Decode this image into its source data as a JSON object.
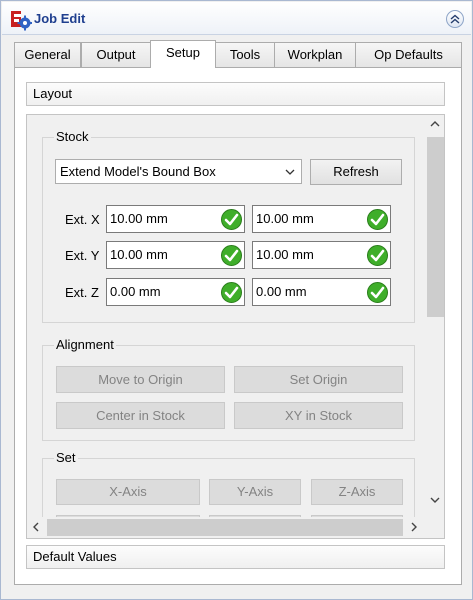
{
  "window": {
    "title": "Job Edit",
    "app_icon": "freecad-path-gear-icon",
    "collapse_icon": "double-chevron-up-icon"
  },
  "tabs": [
    {
      "label": "General",
      "active": false
    },
    {
      "label": "Output",
      "active": false
    },
    {
      "label": "Setup",
      "active": true
    },
    {
      "label": "Tools",
      "active": false
    },
    {
      "label": "Workplan",
      "active": false
    },
    {
      "label": "Op Defaults",
      "active": false
    }
  ],
  "sections": {
    "layout": "Layout",
    "default_values": "Default Values"
  },
  "stock": {
    "title": "Stock",
    "mode_selected": "Extend Model's Bound Box",
    "refresh_label": "Refresh",
    "rows": [
      {
        "label": "Ext. X",
        "neg": "10.00 mm",
        "pos": "10.00 mm"
      },
      {
        "label": "Ext. Y",
        "neg": "10.00 mm",
        "pos": "10.00 mm"
      },
      {
        "label": "Ext. Z",
        "neg": "0.00 mm",
        "pos": "0.00 mm"
      }
    ]
  },
  "alignment": {
    "title": "Alignment",
    "move_to_origin": "Move to Origin",
    "set_origin": "Set Origin",
    "center_in_stock": "Center in Stock",
    "xy_in_stock": "XY in Stock"
  },
  "set": {
    "title": "Set",
    "x_axis": "X-Axis",
    "y_axis": "Y-Axis",
    "z_axis": "Z-Axis"
  },
  "colors": {
    "title_text": "#1f3f8f",
    "valid_check": "#3fae2a",
    "disabled_text": "#838383"
  }
}
